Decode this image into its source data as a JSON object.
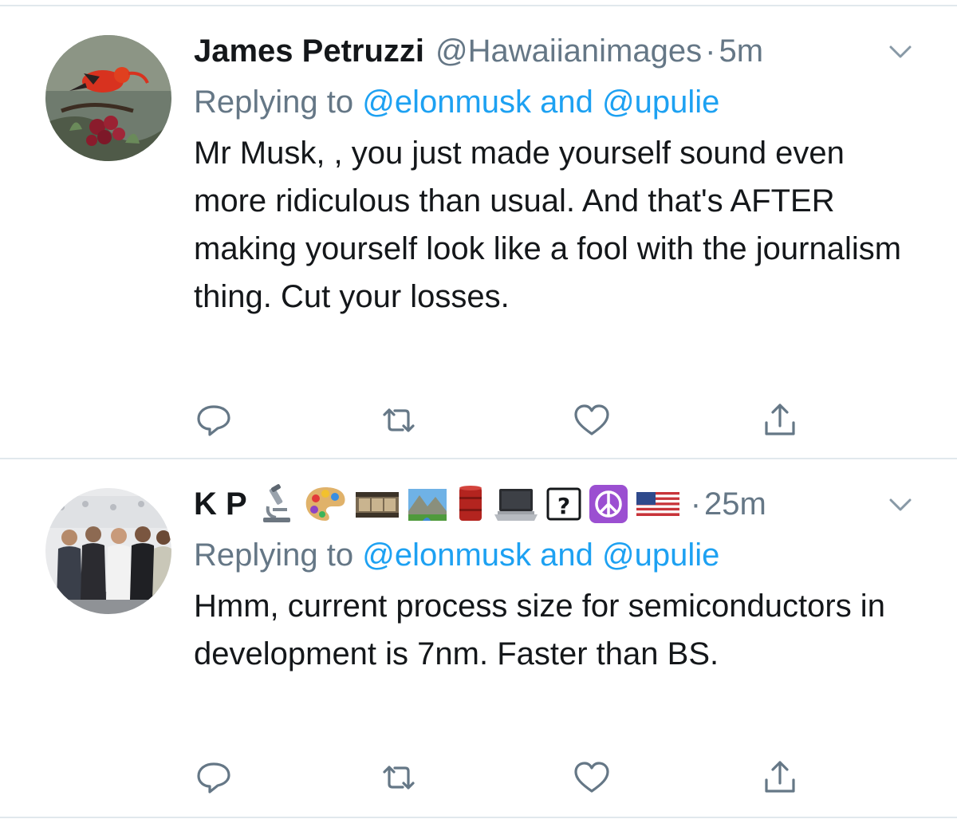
{
  "tweets": [
    {
      "display_name": "James Petruzzi",
      "handle": "@Hawaiianimages",
      "separator": "·",
      "time": "5m",
      "avatar_icon": "bird-on-flower-avatar",
      "name_emojis": [],
      "reply_prefix": "Replying to",
      "reply_mention_1": "@elonmusk",
      "reply_and": "and",
      "reply_mention_2": "@upulie",
      "text": "Mr Musk, , you just made yourself sound even more ridiculous than usual. And that's AFTER making yourself look like a fool with the journalism thing. Cut your losses."
    },
    {
      "display_name": "K P",
      "handle": "",
      "separator": "·",
      "time": "25m",
      "avatar_icon": "group-photo-avatar",
      "name_emojis": [
        "microscope-emoji",
        "artist-palette-emoji",
        "film-frames-emoji",
        "national-park-emoji",
        "oil-drum-emoji",
        "laptop-emoji",
        "question-box-emoji",
        "peace-symbol-emoji",
        "us-flag-emoji"
      ],
      "reply_prefix": "Replying to",
      "reply_mention_1": "@elonmusk",
      "reply_and": "and",
      "reply_mention_2": "@upulie",
      "text": "Hmm, current process size for semiconductors in development is 7nm. Faster than BS."
    }
  ],
  "actions": [
    "reply-icon",
    "retweet-icon",
    "like-icon",
    "share-icon"
  ],
  "colors": {
    "accent": "#1da1f2",
    "secondary_text": "#657786",
    "primary_text": "#14171a",
    "icon": "#657786",
    "divider": "#e1e8ed"
  }
}
